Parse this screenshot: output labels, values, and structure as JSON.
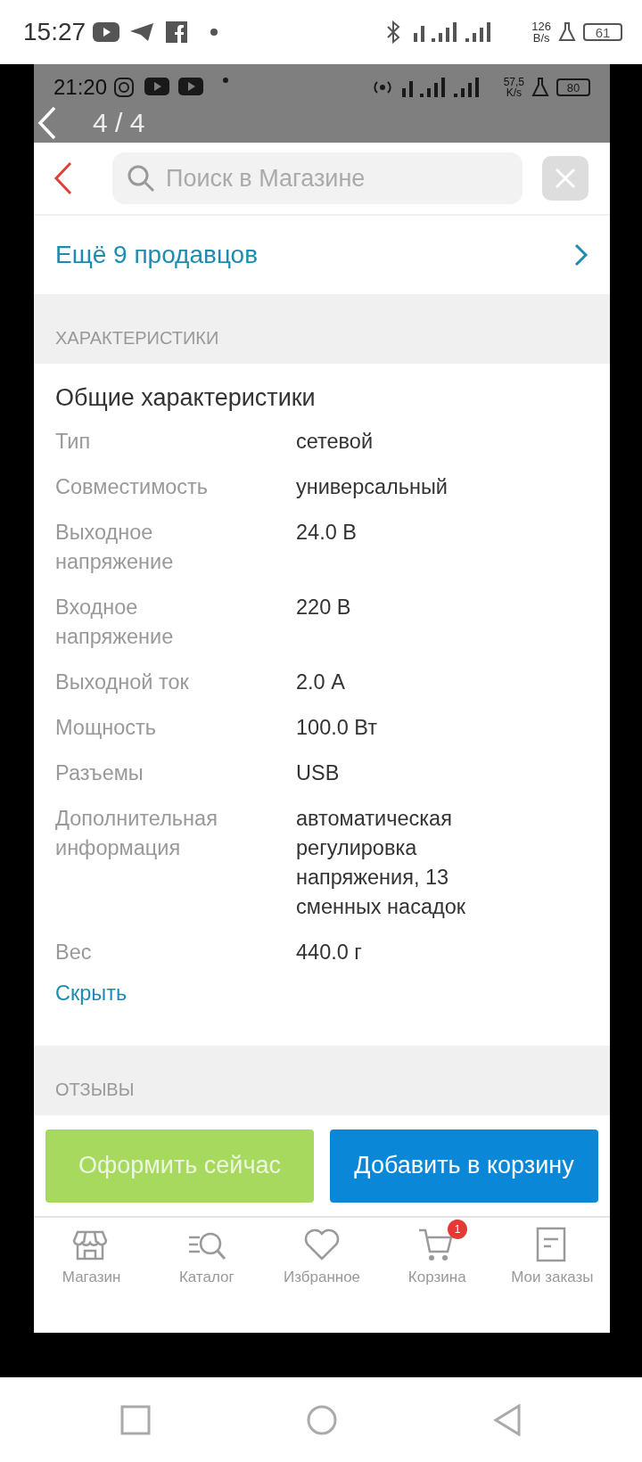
{
  "status_bar": {
    "time": "15:27",
    "speed": "126",
    "speed_unit": "B/s",
    "battery": "61"
  },
  "viewer": {
    "counter": "4 / 4"
  },
  "screenshot": {
    "status_bar": {
      "time": "21:20",
      "speed": "57,5",
      "speed_unit": "K/s",
      "battery": "80"
    },
    "search": {
      "placeholder": "Поиск в Магазине"
    },
    "sellers_link": "Ещё 9 продавцов",
    "specs_header": "ХАРАКТЕРИСТИКИ",
    "specs_group": "Общие характеристики",
    "specs": [
      {
        "label": "Тип",
        "value": "сетевой"
      },
      {
        "label": "Совместимость",
        "value": "универсальный"
      },
      {
        "label": "Выходное напряжение",
        "value": "24.0 В"
      },
      {
        "label": "Входное напряжение",
        "value": "220 В"
      },
      {
        "label": "Выходной ток",
        "value": "2.0 А"
      },
      {
        "label": "Мощность",
        "value": "100.0 Вт"
      },
      {
        "label": "Разъемы",
        "value": "USB"
      },
      {
        "label": "Дополнительная информация",
        "value": "автоматическая регулировка напряжения, 13 сменных насадок"
      },
      {
        "label": "Вес",
        "value": "440.0 г"
      }
    ],
    "collapse_link": "Скрыть",
    "reviews_header": "ОТЗЫВЫ",
    "buttons": [
      {
        "label": "Оформить сейчас",
        "kind": "checkout"
      },
      {
        "label": "Добавить в корзину",
        "kind": "cart"
      }
    ],
    "nav": [
      {
        "label": "Магазин",
        "kind": "store"
      },
      {
        "label": "Каталог",
        "kind": "catalog"
      },
      {
        "label": "Избранное",
        "kind": "favorites"
      },
      {
        "label": "Корзина",
        "kind": "cart",
        "badge": "1"
      },
      {
        "label": "Мои заказы",
        "kind": "orders"
      }
    ]
  }
}
